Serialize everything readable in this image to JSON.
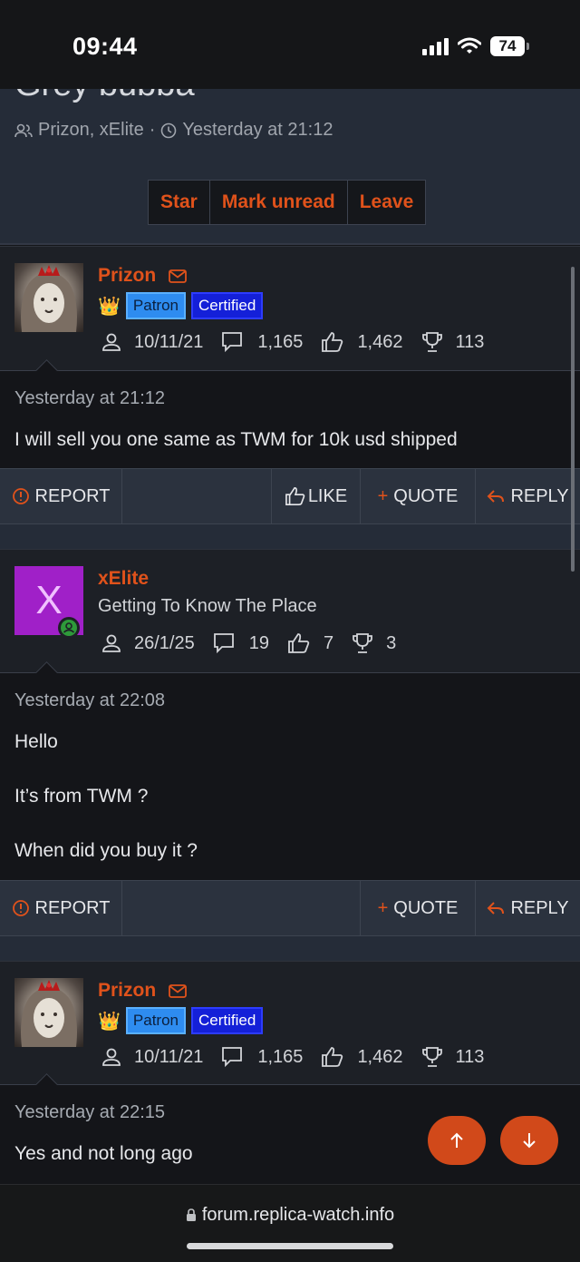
{
  "status_bar": {
    "time": "09:44",
    "battery": "74"
  },
  "thread": {
    "title": "Grey bubba",
    "participants": "Prizon, xElite",
    "separator": "·",
    "date": "Yesterday at 21:12",
    "actions": [
      "Star",
      "Mark unread",
      "Leave"
    ]
  },
  "posts": [
    {
      "username": "Prizon",
      "badges": [
        "Patron",
        "Certified"
      ],
      "stats": {
        "joined": "10/11/21",
        "messages": "1,165",
        "reactions": "1,462",
        "points": "113"
      },
      "date": "Yesterday at 21:12",
      "lines": [
        "I will sell you one same as TWM for 10k usd shipped"
      ],
      "actions": {
        "report": "REPORT",
        "like": "LIKE",
        "quote": "QUOTE",
        "reply": "REPLY"
      }
    },
    {
      "username": "xElite",
      "avatar_letter": "X",
      "user_title": "Getting To Know The Place",
      "stats": {
        "joined": "26/1/25",
        "messages": "19",
        "reactions": "7",
        "points": "3"
      },
      "date": "Yesterday at 22:08",
      "lines": [
        "Hello",
        "It’s from TWM ?",
        "When did you buy it ?"
      ],
      "actions": {
        "report": "REPORT",
        "quote": "QUOTE",
        "reply": "REPLY"
      }
    },
    {
      "username": "Prizon",
      "badges": [
        "Patron",
        "Certified"
      ],
      "stats": {
        "joined": "10/11/21",
        "messages": "1,165",
        "reactions": "1,462",
        "points": "113"
      },
      "date": "Yesterday at 22:15",
      "lines": [
        "Yes and not long ago"
      ]
    }
  ],
  "browser": {
    "url": "forum.replica-watch.info"
  },
  "colors": {
    "accent": "#e0521b",
    "patron": "#2e8cf0",
    "certified": "#1420d8",
    "avatar_x": "#a020c8"
  }
}
